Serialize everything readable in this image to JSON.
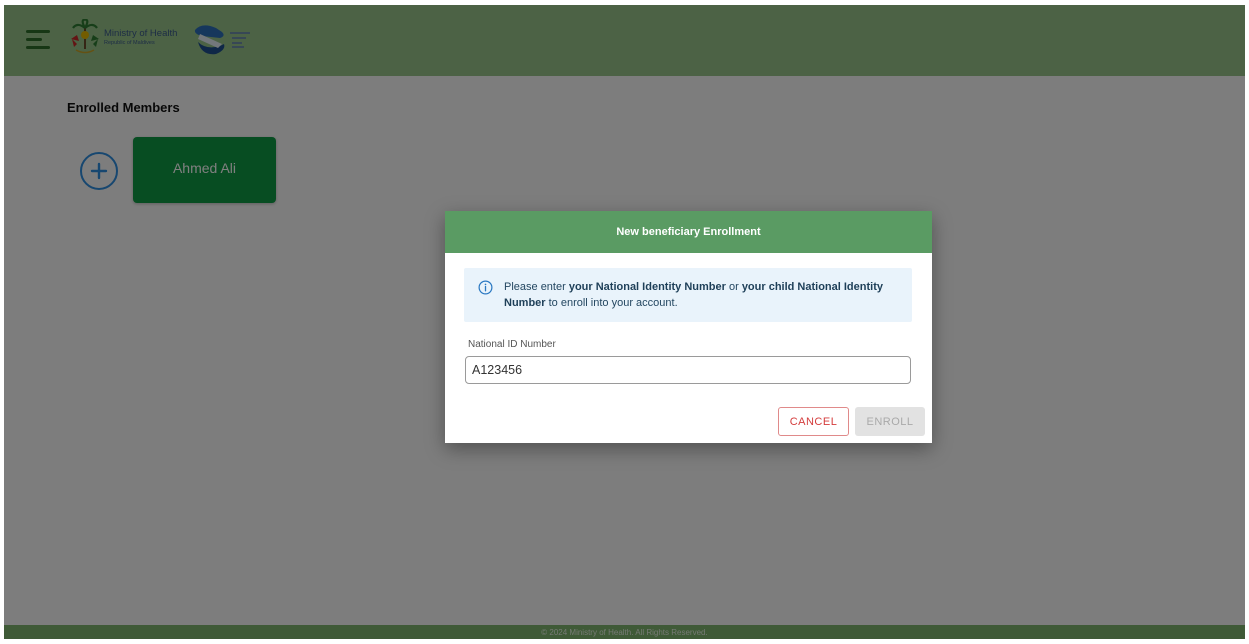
{
  "header": {
    "ministry_title": "Ministry of Health",
    "ministry_subtitle": "Republic of Maldives"
  },
  "section": {
    "title": "Enrolled Members"
  },
  "members": [
    {
      "name": "Ahmed Ali"
    }
  ],
  "footer": {
    "text": "© 2024 Ministry of Health. All Rights Reserved."
  },
  "modal": {
    "title": "New beneficiary Enrollment",
    "info": {
      "text_1": "Please enter ",
      "bold_1": "your National Identity Number",
      "text_2": " or ",
      "bold_2": "your child National Identity Number",
      "text_3": " to enroll into your account."
    },
    "field_label": "National ID Number",
    "field_value": "A123456",
    "cancel_label": "CANCEL",
    "enroll_label": "ENROLL"
  },
  "colors": {
    "header": "#98c48b",
    "member_card": "#0f9a44",
    "modal_header": "#5a9b63",
    "info_bg": "#e9f3fb",
    "cancel": "#d43c3c",
    "add_icon": "#2f8ee0"
  },
  "icons": {
    "menu": "menu-icon",
    "emblem": "national-emblem-icon",
    "brand_logo": "aasandha-logo-icon",
    "add": "plus-circle-icon",
    "info": "info-icon"
  }
}
